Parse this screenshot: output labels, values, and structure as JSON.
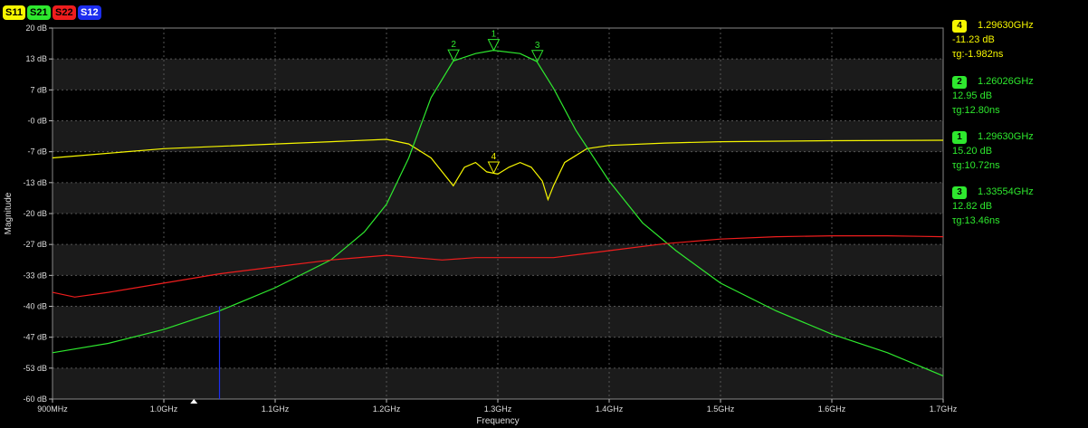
{
  "trace_tabs": [
    {
      "label": "S11",
      "color": "#f7f700"
    },
    {
      "label": "S21",
      "color": "#2ee82e"
    },
    {
      "label": "S22",
      "color": "#ef1d1d"
    },
    {
      "label": "S12",
      "color": "#1d2ef0"
    }
  ],
  "markers": [
    {
      "num": "4",
      "freq": "1.29630GHz",
      "val": "-11.23 dB",
      "tg": "τg:-1.982ns",
      "color": "#f7f700"
    },
    {
      "num": "2",
      "freq": "1.26026GHz",
      "val": "12.95 dB",
      "tg": "τg:12.80ns",
      "color": "#2ee82e"
    },
    {
      "num": "1",
      "freq": "1.29630GHz",
      "val": "15.20 dB",
      "tg": "τg:10.72ns",
      "color": "#2ee82e"
    },
    {
      "num": "3",
      "freq": "1.33554GHz",
      "val": "12.82 dB",
      "tg": "τg:13.46ns",
      "color": "#2ee82e"
    }
  ],
  "chart_data": {
    "type": "line",
    "xlabel": "Frequency",
    "ylabel": "Magnitude",
    "xlim": [
      0.9,
      1.7
    ],
    "ylim": [
      -60,
      20
    ],
    "grid": true,
    "x_ticks": [
      "900MHz",
      "1.0GHz",
      "1.1GHz",
      "1.2GHz",
      "1.3GHz",
      "1.4GHz",
      "1.5GHz",
      "1.6GHz",
      "1.7GHz"
    ],
    "y_ticks": [
      "20 dB",
      "13 dB",
      "7 dB",
      "-0 dB",
      "-7 dB",
      "-13 dB",
      "-20 dB",
      "-27 dB",
      "-33 dB",
      "-40 dB",
      "-47 dB",
      "-53 dB",
      "-60 dB"
    ],
    "series": [
      {
        "name": "S11",
        "color": "#f7f700",
        "x": [
          0.9,
          0.95,
          1.0,
          1.05,
          1.1,
          1.15,
          1.2,
          1.22,
          1.24,
          1.25,
          1.26,
          1.27,
          1.28,
          1.29,
          1.3,
          1.31,
          1.32,
          1.33,
          1.34,
          1.345,
          1.35,
          1.36,
          1.38,
          1.4,
          1.45,
          1.5,
          1.6,
          1.7
        ],
        "y": [
          -8,
          -7,
          -6,
          -5.5,
          -5,
          -4.5,
          -4,
          -5,
          -8,
          -11,
          -14,
          -10,
          -9,
          -11,
          -11.5,
          -10,
          -9,
          -10,
          -13,
          -17,
          -14,
          -9,
          -6,
          -5.3,
          -4.8,
          -4.5,
          -4.3,
          -4.2
        ]
      },
      {
        "name": "S21",
        "color": "#2ee82e",
        "x": [
          0.9,
          0.95,
          1.0,
          1.05,
          1.1,
          1.15,
          1.18,
          1.2,
          1.22,
          1.24,
          1.26,
          1.28,
          1.296,
          1.32,
          1.335,
          1.35,
          1.37,
          1.4,
          1.43,
          1.46,
          1.5,
          1.55,
          1.6,
          1.65,
          1.7
        ],
        "y": [
          -50,
          -48,
          -45,
          -41,
          -36,
          -30,
          -24,
          -18,
          -8,
          5,
          12.9,
          14.5,
          15.2,
          14.5,
          12.8,
          7,
          -2,
          -13,
          -22,
          -28,
          -35,
          -41,
          -46,
          -50,
          -55
        ]
      },
      {
        "name": "S22",
        "color": "#ef1d1d",
        "x": [
          0.9,
          0.92,
          0.95,
          1.0,
          1.05,
          1.1,
          1.15,
          1.2,
          1.25,
          1.28,
          1.3,
          1.35,
          1.4,
          1.45,
          1.5,
          1.55,
          1.6,
          1.65,
          1.7
        ],
        "y": [
          -37,
          -38,
          -37,
          -35,
          -33,
          -31.5,
          -30,
          -29,
          -30,
          -29.5,
          -29.5,
          -29.5,
          -28,
          -26.5,
          -25.5,
          -25,
          -24.8,
          -24.8,
          -25
        ]
      },
      {
        "name": "S12",
        "color": "#1d2ef0",
        "x": [
          1.05,
          1.05
        ],
        "y": [
          -40,
          -60
        ]
      }
    ],
    "marker_points": [
      {
        "num": "1",
        "x": 1.2963,
        "y": 15.2,
        "trace": "S21"
      },
      {
        "num": "2",
        "x": 1.26026,
        "y": 12.95,
        "trace": "S21"
      },
      {
        "num": "3",
        "x": 1.33554,
        "y": 12.82,
        "trace": "S21"
      },
      {
        "num": "4",
        "x": 1.2963,
        "y": -11.23,
        "trace": "S11"
      }
    ]
  }
}
